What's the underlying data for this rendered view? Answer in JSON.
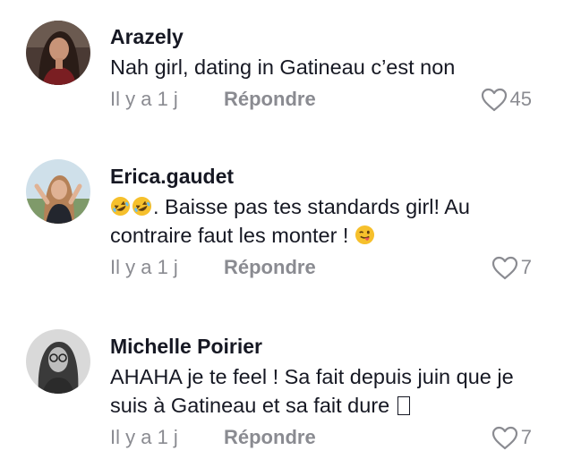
{
  "comments": [
    {
      "username": "Arazely",
      "text": "Nah girl, dating in Gatineau c’est non",
      "time": "Il y a 1 j",
      "reply_label": "Répondre",
      "likes": "45"
    },
    {
      "username": "Erica.gaudet",
      "emoji_prefix": [
        "rolling-on-floor-laughing",
        "rolling-on-floor-laughing"
      ],
      "text": ". Baisse pas tes standards girl! Au contraire faut les monter ! ",
      "emoji_suffix": "winking-face-with-tongue",
      "time": "Il y a 1 j",
      "reply_label": "Répondre",
      "likes": "7"
    },
    {
      "username": "Michelle Poirier",
      "text": "AHAHA je te feel ! Sa fait depuis juin que je suis à Gatineau et sa fait dure ",
      "trailing_glyph": "missing-glyph-box",
      "time": "Il y a 1 j",
      "reply_label": "Répondre",
      "likes": "7"
    }
  ],
  "colors": {
    "text": "#161823",
    "secondary": "#8a8b91",
    "background": "#ffffff"
  }
}
